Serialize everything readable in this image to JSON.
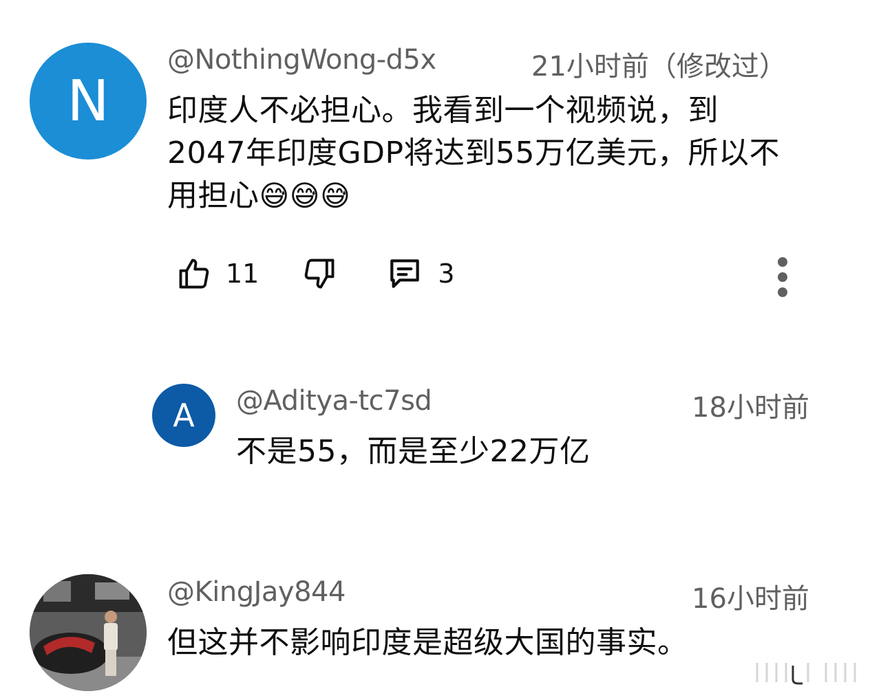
{
  "comments": [
    {
      "avatar_letter": "N",
      "avatar_color": "#1b8ed6",
      "handle": "@NothingWong-d5x",
      "time": "21小时前（修改过）",
      "text_lines": [
        "印度人不必担心。我看到一个视频说，到",
        "2047年印度GDP将达到55万亿美元，所以不",
        "用担心"
      ],
      "emojis": "😅😅😅",
      "likes": "11",
      "replies": "3"
    },
    {
      "avatar_letter": "A",
      "avatar_color": "#0d5aa7",
      "handle": "@Aditya-tc7sd",
      "time": "18小时前",
      "text": "不是55，而是至少22万亿"
    },
    {
      "avatar_letter": "",
      "avatar_color": "#4a4a4a",
      "handle": "@KingJay844",
      "time": "16小时前",
      "text": "但这并不影响印度是超级大国的事实。"
    }
  ],
  "icons": {
    "like": "thumbs-up-icon",
    "dislike": "thumbs-down-icon",
    "reply": "comment-icon",
    "more": "more-vertical-icon"
  }
}
